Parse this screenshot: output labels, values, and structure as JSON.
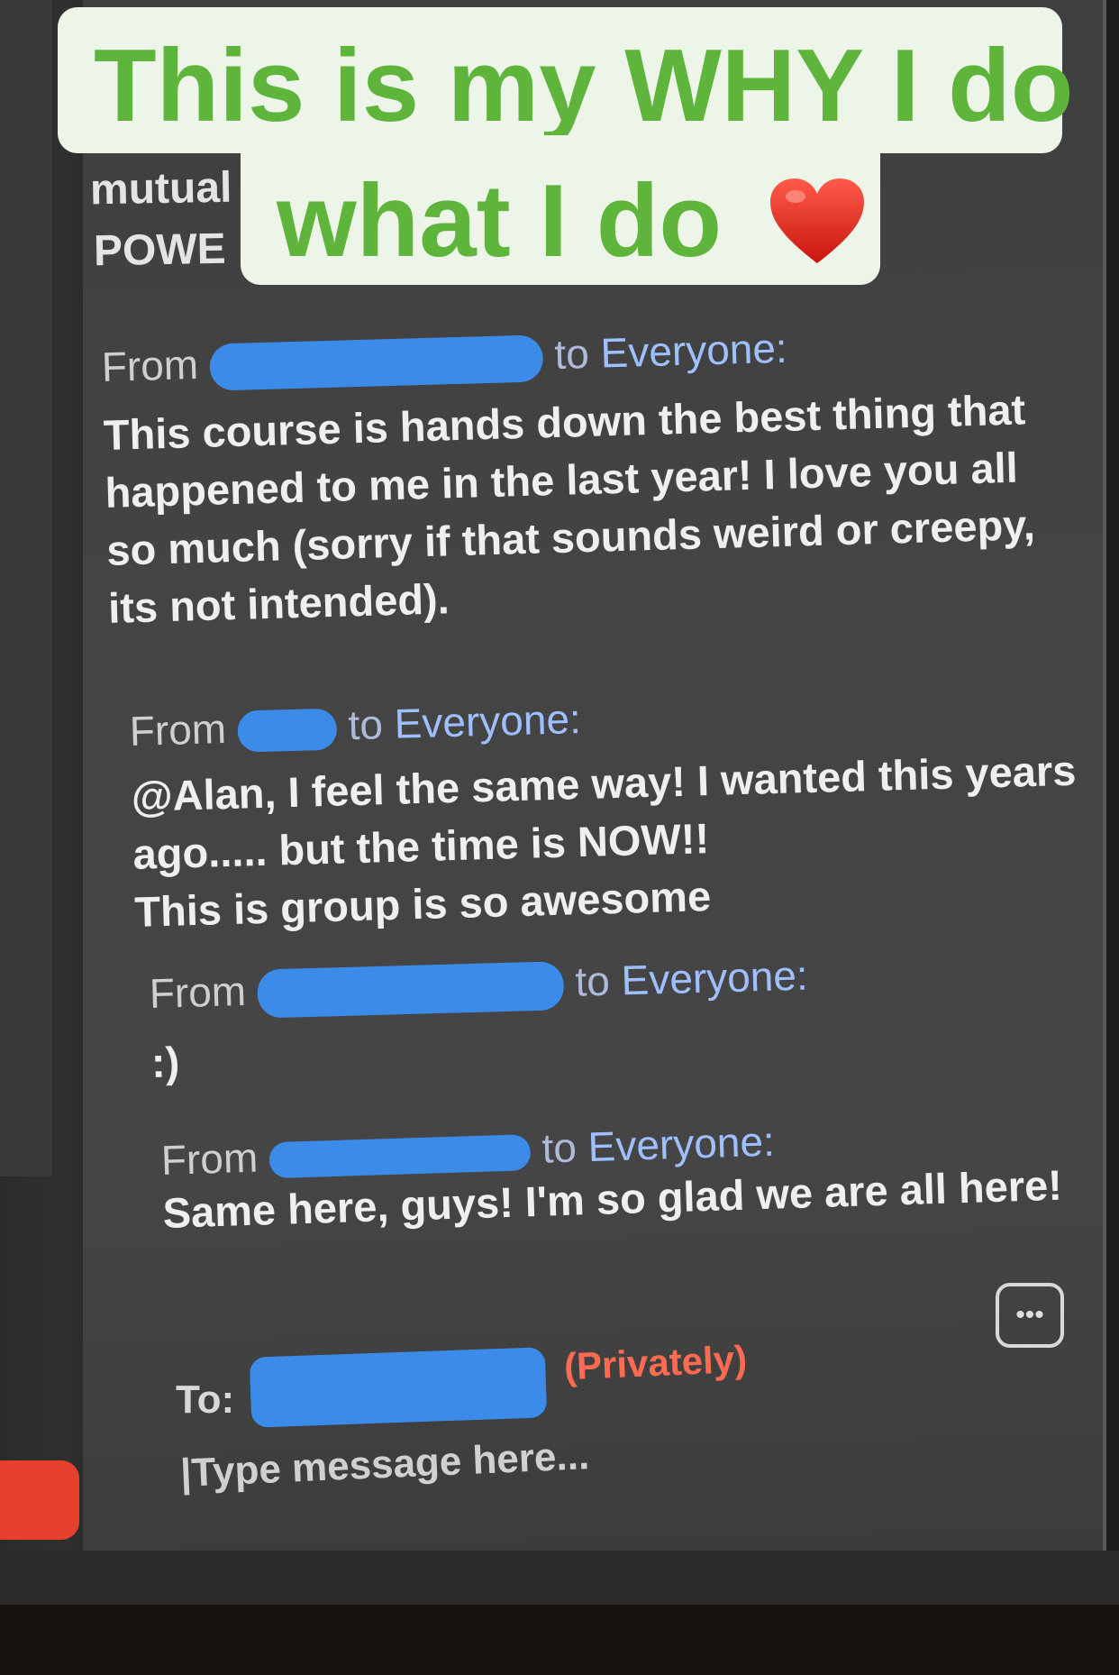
{
  "overlay": {
    "line1": "This is my WHY I do",
    "line2": "what I do",
    "heart_icon": "heart-icon",
    "text_color": "#5fb53b"
  },
  "background_fragments": {
    "line1": "mutual",
    "line2": "POWE"
  },
  "chat": {
    "messages": [
      {
        "from_label": "From",
        "to_label": "to",
        "recipient": "Everyone:",
        "body": [
          "This course is hands down the best thing that",
          "happened to me in the last year! I love you all",
          "so much (sorry if that sounds weird or creepy,",
          "its not intended)."
        ]
      },
      {
        "from_label": "From",
        "to_label": "to",
        "recipient": "Everyone:",
        "body": [
          "@Alan, I feel the same way! I wanted this years",
          "ago..... but the time is NOW!!",
          "This is group is so awesome"
        ]
      },
      {
        "from_label": "From",
        "to_label": "to",
        "recipient": "Everyone:",
        "body": [
          ":)"
        ]
      },
      {
        "from_label": "From",
        "to_label": "to",
        "recipient": "Everyone:",
        "body": [
          "Same here, guys! I'm so glad we are all here!"
        ]
      }
    ],
    "compose": {
      "to_label": "To:",
      "privately": "(Privately)",
      "placeholder": "Type message here...",
      "more_icon": "ellipsis-icon"
    }
  },
  "colors": {
    "redaction": "#3d8be8",
    "everyone_link": "#9ec0ff",
    "private_red": "#ff6a52",
    "side_button_red": "#e5412d"
  }
}
